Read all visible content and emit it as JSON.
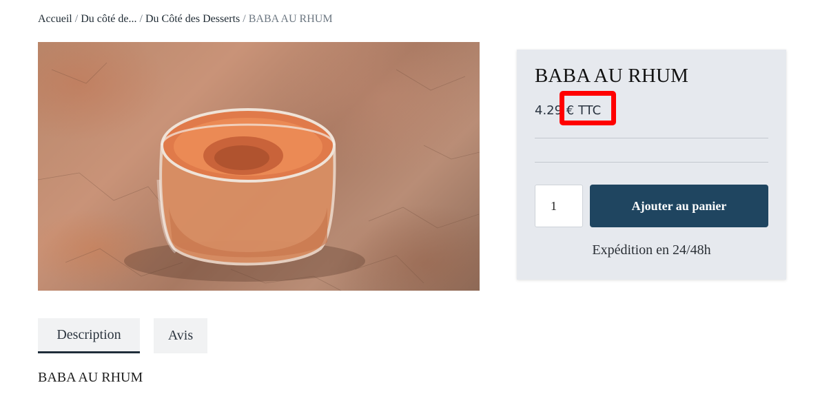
{
  "breadcrumb": {
    "items": [
      "Accueil",
      "Du côté de...",
      "Du Côté des Desserts"
    ],
    "separator": "/",
    "current": "BABA AU RHUM"
  },
  "product": {
    "image_alt": "Baba au rhum en verrine",
    "title": "BABA AU RHUM",
    "price": "4.29 € TTC",
    "quantity": "1",
    "add_to_cart_label": "Ajouter au panier",
    "shipping": "Expédition en 24/48h"
  },
  "tabs": [
    {
      "label": "Description",
      "active": true
    },
    {
      "label": "Avis",
      "active": false
    }
  ],
  "description": {
    "text": "BABA AU RHUM"
  },
  "colors": {
    "button": "#1f4560",
    "annotation": "#ff0000",
    "panel": "#e6e9ee"
  }
}
